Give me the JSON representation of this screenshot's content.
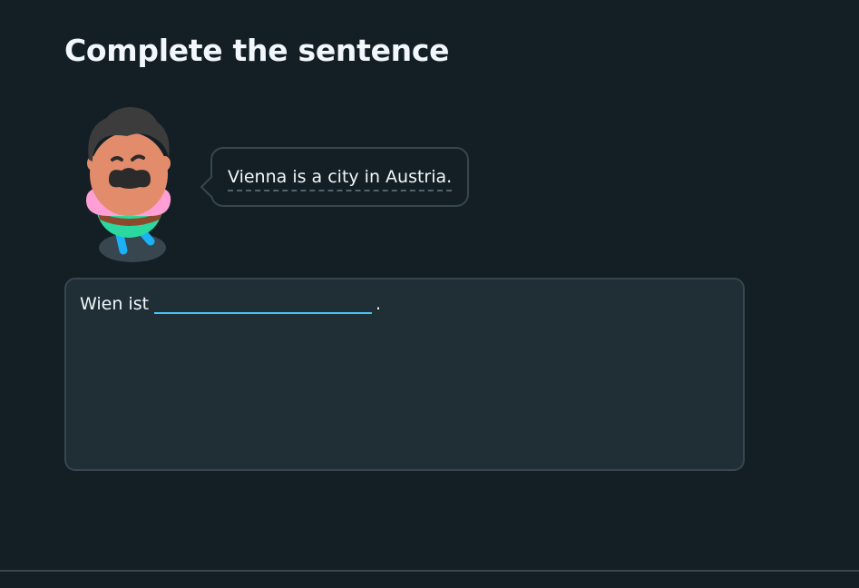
{
  "exercise": {
    "title": "Complete the sentence",
    "prompt": "Vienna is a city in Austria.",
    "sentence_prefix": "Wien ist",
    "blank_value": "",
    "sentence_suffix": "."
  },
  "character": {
    "icon": "mustached-character-icon",
    "colors": {
      "hair": "#3c3c3c",
      "skin": "#e38c6b",
      "scarf": "#ff9fd6",
      "shirt": "#2bd9a0",
      "shoes": "#1cb0f6"
    }
  },
  "colors": {
    "background": "#131f24",
    "panel": "#202f36",
    "border": "#37464f",
    "input_underline": "#49c0f8",
    "text": "#f1f7fb"
  }
}
